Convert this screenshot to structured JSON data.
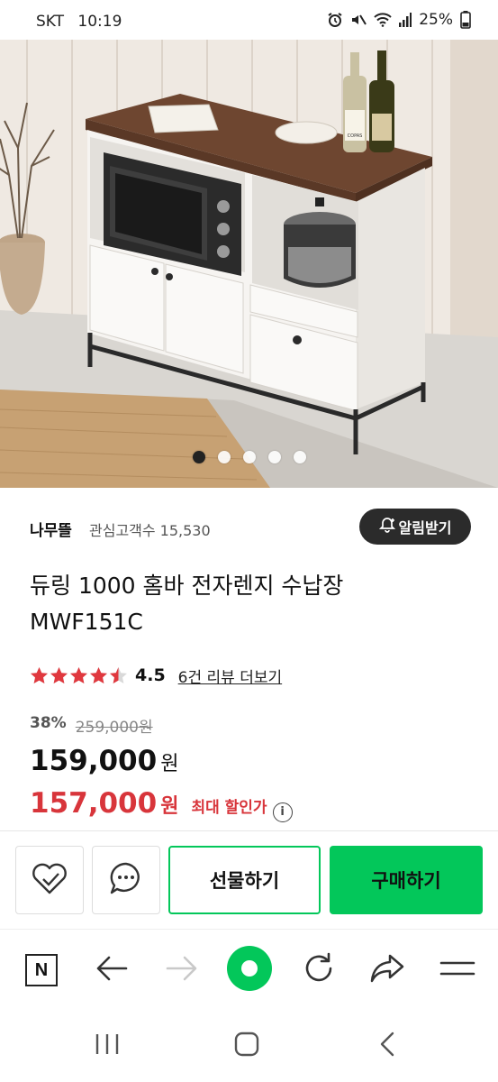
{
  "status": {
    "carrier": "SKT",
    "time": "10:19",
    "battery": "25%"
  },
  "gallery": {
    "image_count": 5,
    "active_index": 0,
    "image_text": {
      "wine_label": "COPAS"
    }
  },
  "seller": {
    "name": "나무뜰",
    "fans_label": "관심고객수 15,530",
    "alarm_button": "알림받기"
  },
  "product": {
    "title_line1": "듀링 1000 홈바 전자렌지 수납장",
    "title_line2": "MWF151C",
    "rating": "4.5",
    "rating_stars": 4.5,
    "review_link": "6건 리뷰 더보기",
    "discount_rate": "38%",
    "original_price": "259,000원",
    "price": "159,000",
    "price_unit": "원",
    "max_discount_price": "157,000",
    "max_discount_unit": "원",
    "max_discount_label": "최대 할인가",
    "info_glyph": "i"
  },
  "actions": {
    "gift_button": "선물하기",
    "buy_button": "구매하기"
  },
  "browser_toolbar": {
    "n_logo": "N"
  },
  "colors": {
    "accent_green": "#03c75a",
    "sale_red": "#d8353b",
    "star_red": "#e0383e",
    "dark_button": "#2b2b2b"
  }
}
